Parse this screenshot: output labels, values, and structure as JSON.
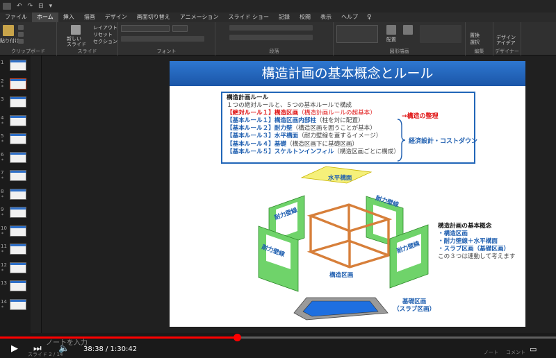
{
  "window": {
    "qa_label": "ファイル"
  },
  "ribbon_tabs": [
    "ファイル",
    "ホーム",
    "挿入",
    "描画",
    "デザイン",
    "画面切り替え",
    "アニメーション",
    "スライド ショー",
    "記録",
    "校閲",
    "表示",
    "ヘルプ"
  ],
  "active_tab": 1,
  "ribbon": {
    "clipboard_label": "クリップボード",
    "paste_label": "貼り付け",
    "slides_label": "スライド",
    "new_slide_label": "新しい\nスライド",
    "layout_label": "レイアウト",
    "reset_label": "リセット",
    "section_label": "セクション",
    "font_label": "フォント",
    "paragraph_label": "段落",
    "drawing_label": "図形描画",
    "arrange_label": "配置",
    "editing_label": "編集",
    "replace_label": "置換",
    "select_label": "選択",
    "designer_label": "デザイン\nアイデア",
    "designer_group": "デザイナー"
  },
  "thumbnails": [
    {
      "num": "1",
      "star": "",
      "active": false
    },
    {
      "num": "2",
      "star": "*",
      "active": true
    },
    {
      "num": "3",
      "star": "",
      "active": false
    },
    {
      "num": "4",
      "star": "*",
      "active": false
    },
    {
      "num": "5",
      "star": "*",
      "active": false
    },
    {
      "num": "6",
      "star": "*",
      "active": false
    },
    {
      "num": "7",
      "star": "*",
      "active": false
    },
    {
      "num": "8",
      "star": "*",
      "active": false
    },
    {
      "num": "9",
      "star": "*",
      "active": false
    },
    {
      "num": "10",
      "star": "*",
      "active": false
    },
    {
      "num": "11",
      "star": "*",
      "active": false
    },
    {
      "num": "12",
      "star": "*",
      "active": false
    },
    {
      "num": "13",
      "star": "",
      "active": false
    },
    {
      "num": "14",
      "star": "*",
      "active": false
    }
  ],
  "slide": {
    "title": "構造計画の基本概念とルール",
    "rules_heading": "構造計画ルール",
    "rules_intro": "１つの絶対ルールと、５つの基本ルールで構成",
    "rule_absolute": "【絶対ルール１】構造区画",
    "rule_absolute_note": "（構造計画ルールの超基本）",
    "rule1": "【基本ルール１】構造区画内部柱",
    "rule1_note": "（柱を対に配置）",
    "rule2": "【基本ルール２】耐力壁",
    "rule2_note": "（構造区画を囲うことが基本）",
    "rule3": "【基本ルール３】水平構面",
    "rule3_note": "（耐力壁線を蓋するイメージ）",
    "rule4": "【基本ルール４】基礎",
    "rule4_note": "（構造区画下に基礎区画）",
    "rule5": "【基本ルール５】スケルトンインフィル",
    "rule5_note": "（構造区画ごとに構成）",
    "note_arrangement": "→構造の整理",
    "note_economy": "経済設計・コストダウン",
    "label_horizontal": "水平構面",
    "label_wall_tl": "耐力壁線",
    "label_wall_tr": "耐力壁線",
    "label_wall_l": "耐力壁線",
    "label_wall_r": "耐力壁線",
    "label_block": "構造区画",
    "label_foundation": "基礎区画\n（スラブ区画）",
    "concept_heading": "構造計画の基本概念",
    "concept_1": "・構造区画",
    "concept_2": "・耐力壁線＋水平構面",
    "concept_3": "・スラブ区画（基礎区画）",
    "concept_4": "この３つは連動して考えます"
  },
  "notes_placeholder": "ノートを入力",
  "video": {
    "time": "38:38 / 1:30:42",
    "progress": 0.4259
  },
  "status_left": "スライド 2 / 14",
  "status_notes": "ノート",
  "status_comment": "コメント",
  "colors": {
    "accent_red": "#e01414",
    "accent_blue": "#1f5fb0",
    "wall_green": "#6fd36a",
    "frame_orange": "#d77f3a",
    "horizontal_yellow": "#f5f07a"
  }
}
